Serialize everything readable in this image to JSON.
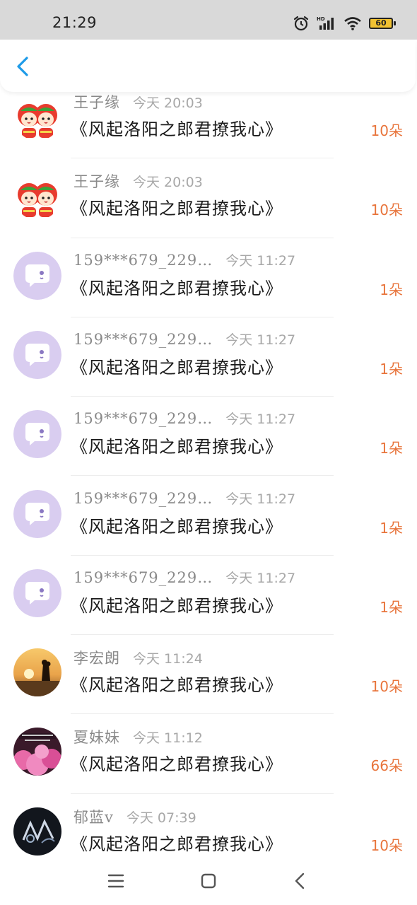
{
  "status_bar": {
    "time": "21:29",
    "battery": "60",
    "icons": [
      "alarm-icon",
      "hd-signal-icon",
      "wifi-icon",
      "battery-icon"
    ]
  },
  "header": {
    "back_icon": "chevron-left-icon"
  },
  "colors": {
    "accent_blue": "#1e9be8",
    "amount_orange": "#e8743b",
    "bot_avatar_purple": "#d9cdf0"
  },
  "items": [
    {
      "avatar": "apple-mascot",
      "name": "王子缘",
      "time": "今天 20:03",
      "title": "《风起洛阳之郎君撩我心》",
      "amount": "10朵"
    },
    {
      "avatar": "apple-mascot",
      "name": "王子缘",
      "time": "今天 20:03",
      "title": "《风起洛阳之郎君撩我心》",
      "amount": "10朵"
    },
    {
      "avatar": "chat-bubble",
      "name": "159***679_229…",
      "time": "今天 11:27",
      "title": "《风起洛阳之郎君撩我心》",
      "amount": "1朵"
    },
    {
      "avatar": "chat-bubble",
      "name": "159***679_229…",
      "time": "今天 11:27",
      "title": "《风起洛阳之郎君撩我心》",
      "amount": "1朵"
    },
    {
      "avatar": "chat-bubble",
      "name": "159***679_229…",
      "time": "今天 11:27",
      "title": "《风起洛阳之郎君撩我心》",
      "amount": "1朵"
    },
    {
      "avatar": "chat-bubble",
      "name": "159***679_229…",
      "time": "今天 11:27",
      "title": "《风起洛阳之郎君撩我心》",
      "amount": "1朵"
    },
    {
      "avatar": "chat-bubble",
      "name": "159***679_229…",
      "time": "今天 11:27",
      "title": "《风起洛阳之郎君撩我心》",
      "amount": "1朵"
    },
    {
      "avatar": "sunset-couple",
      "name": "李宏朗",
      "time": "今天 11:24",
      "title": "《风起洛阳之郎君撩我心》",
      "amount": "10朵"
    },
    {
      "avatar": "pink-blossom",
      "name": "夏妹妹",
      "time": "今天 11:12",
      "title": "《风起洛阳之郎君撩我心》",
      "amount": "66朵"
    },
    {
      "avatar": "dark-art",
      "name": "郁蓝v",
      "time": "今天 07:39",
      "title": "《风起洛阳之郎君撩我心》",
      "amount": "10朵"
    }
  ],
  "bottom_nav": {
    "icons": [
      "menu-icon",
      "home-icon",
      "back-icon"
    ]
  }
}
